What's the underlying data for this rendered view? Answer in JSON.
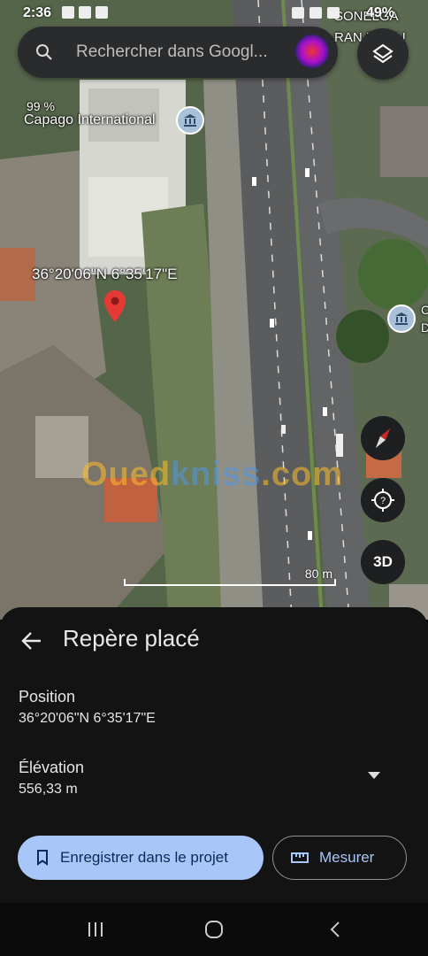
{
  "status_bar": {
    "time": "2:36",
    "battery": "49%"
  },
  "search": {
    "placeholder": "Rechercher dans Googl..."
  },
  "map": {
    "labels": {
      "percent": "99 %",
      "place": "Capago International",
      "coords": "36°20'06\"N 6°35'17\"E",
      "top_right_line1": "SONELGA",
      "top_right_line2": "RAN ET DU",
      "right_edge_1": "C",
      "right_edge_2": "D"
    },
    "watermark": {
      "part1": "Oued",
      "part2": "kniss",
      "part3": ".com"
    },
    "scale_label": "80 m",
    "btn3d_label": "3D"
  },
  "sheet": {
    "title": "Repère placé",
    "position_label": "Position",
    "position_value": "36°20'06\"N 6°35'17\"E",
    "elevation_label": "Élévation",
    "elevation_value": "556,33 m",
    "save_label": "Enregistrer dans le projet",
    "measure_label": "Mesurer"
  },
  "colors": {
    "accent": "#a8c6f7",
    "sheet_bg": "#131314",
    "pin": "#e53935"
  }
}
